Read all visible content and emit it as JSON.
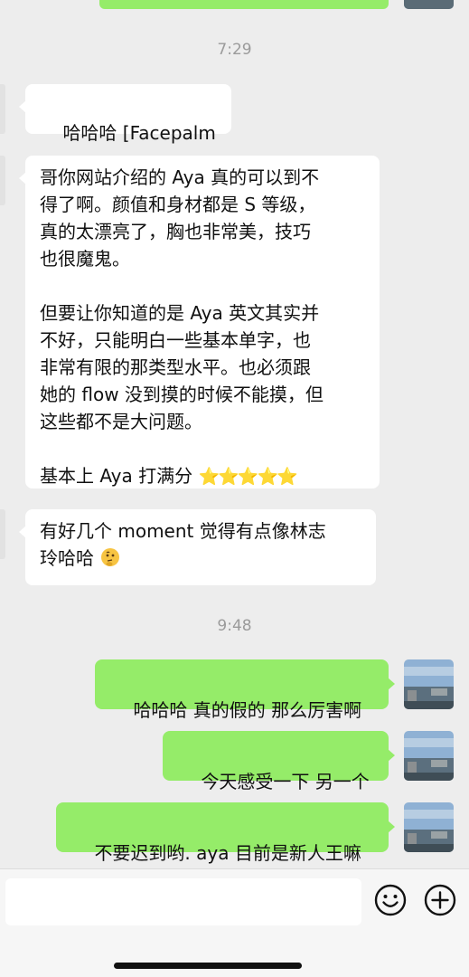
{
  "chat": {
    "time_1": "7:29",
    "time_2": "9:48",
    "incoming": [
      {
        "text": "哈哈哈 [Facepalm"
      },
      {
        "text": "哥你网站介绍的 Aya 真的可以到不\n得了啊。颜值和身材都是 S 等级，\n真的太漂亮了，胸也非常美，技巧\n也很魔鬼。\n\n但要让你知道的是 Aya 英文其实并\n不好，只能明白一些基本单字，也\n非常有限的那类型水平。也必须跟\n她的 flow 没到摸的时候不能摸，但\n这些都不是大问题。\n\n基本上 Aya 打满分 ",
        "stars": "⭐⭐⭐⭐⭐"
      },
      {
        "text": "有好几个 moment 觉得有点像林志\n玲哈哈 "
      }
    ],
    "outgoing": [
      {
        "text": "哈哈哈 真的假的 那么厉害啊"
      },
      {
        "text": "今天感受一下 另一个"
      },
      {
        "text": "不要迟到哟. aya 目前是新人王嘛"
      }
    ]
  },
  "input_bar": {
    "text_value": "",
    "emoji_button": "smiley-icon",
    "plus_button": "plus-icon"
  },
  "colors": {
    "background": "#ededed",
    "outgoing_bubble": "#95ec69",
    "incoming_bubble": "#ffffff"
  }
}
